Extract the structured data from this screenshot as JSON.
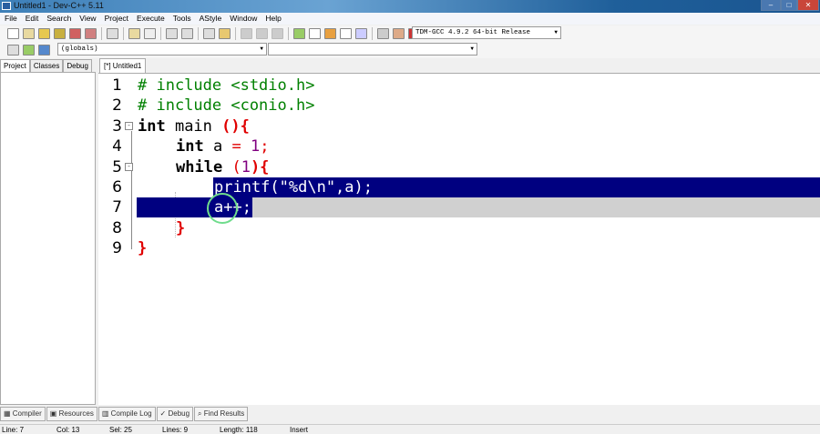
{
  "window": {
    "title": "Untitled1 - Dev-C++ 5.11"
  },
  "menu": [
    "File",
    "Edit",
    "Search",
    "View",
    "Project",
    "Execute",
    "Tools",
    "AStyle",
    "Window",
    "Help"
  ],
  "toolbar": {
    "compiler_select": "TDM-GCC 4.9.2 64-bit Release",
    "scope_select": "(globals)",
    "member_select": ""
  },
  "left_tabs": [
    "Project",
    "Classes",
    "Debug"
  ],
  "editor_tab": "[*] Untitled1",
  "code": {
    "lines": [
      "1",
      "2",
      "3",
      "4",
      "5",
      "6",
      "7",
      "8",
      "9"
    ],
    "l1": "# include <stdio.h>",
    "l2": "# include <conio.h>",
    "l3a": "int",
    "l3b": " main ",
    "l3c": "(){",
    "l4a": "int",
    "l4b": " a ",
    "l4c": "=",
    "l4d": " ",
    "l4e": "1",
    "l4f": ";",
    "l5a": "while",
    "l5b": " ",
    "l5c": "(",
    "l5d": "1",
    "l5e": "){",
    "l6": "printf(\"%d\\n\",a);",
    "l7": "a++;",
    "l8": "}",
    "l9": "}"
  },
  "bottom_tabs": [
    "Compiler",
    "Resources",
    "Compile Log",
    "Debug",
    "Find Results"
  ],
  "status": {
    "line": "Line:   7",
    "col": "Col:   13",
    "sel": "Sel:   25",
    "lines": "Lines:   9",
    "length": "Length:   118",
    "mode": "Insert"
  },
  "colors": {
    "selection": "#000080",
    "preprocessor": "#008000",
    "brace": "#e00000",
    "number": "#800080"
  }
}
